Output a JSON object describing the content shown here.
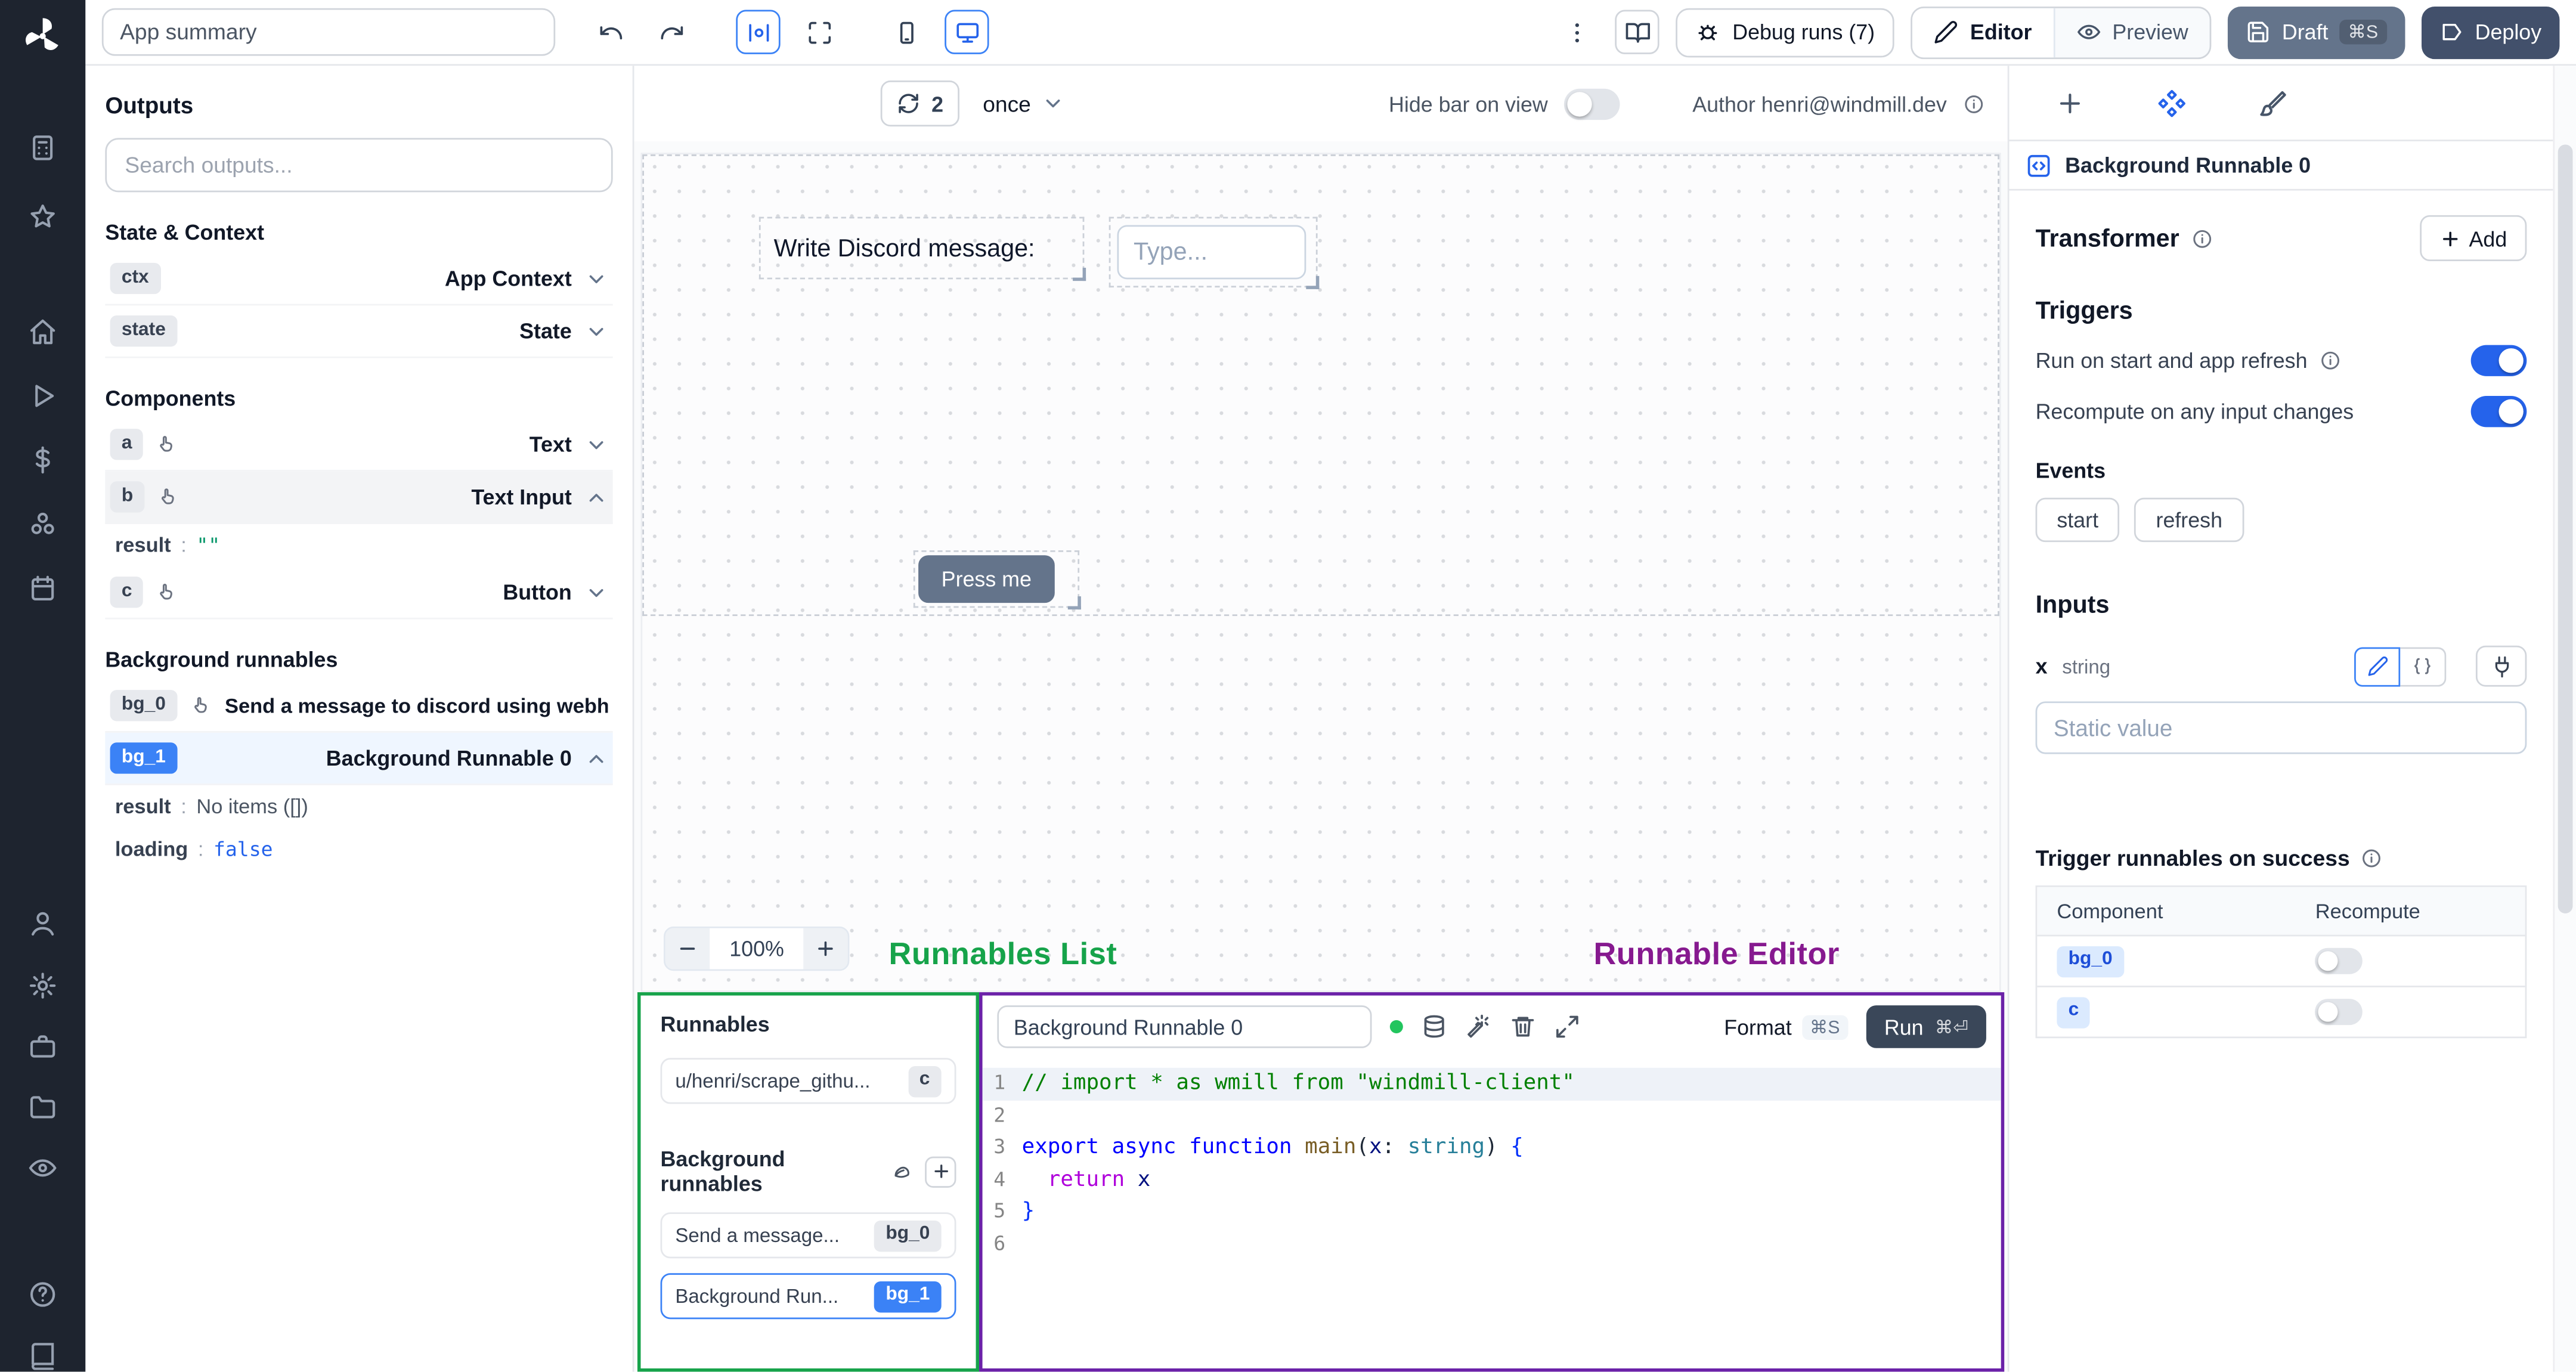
{
  "topbar": {
    "app_summary_value": "App summary",
    "debug_runs_label": "Debug runs (7)",
    "editor_label": "Editor",
    "preview_label": "Preview",
    "draft_label": "Draft",
    "draft_shortcut": "⌘S",
    "deploy_label": "Deploy"
  },
  "outputs": {
    "title": "Outputs",
    "search_placeholder": "Search outputs...",
    "state_context_heading": "State & Context",
    "rows_state": [
      {
        "badge": "ctx",
        "label": "App Context"
      },
      {
        "badge": "state",
        "label": "State"
      }
    ],
    "components_heading": "Components",
    "rows_components": [
      {
        "badge": "a",
        "label": "Text"
      },
      {
        "badge": "b",
        "label": "Text Input"
      },
      {
        "badge": "c",
        "label": "Button"
      }
    ],
    "b_detail": {
      "key": "result",
      "colon": ":",
      "value": "\"\""
    },
    "background_heading": "Background runnables",
    "rows_background": [
      {
        "badge": "bg_0",
        "label": "Send a message to discord using webhoo"
      },
      {
        "badge": "bg_1",
        "label": "Background Runnable 0"
      }
    ],
    "bg1_details": [
      {
        "key": "result",
        "colon": ":",
        "value": "No items ([])"
      },
      {
        "key": "loading",
        "colon": ":",
        "value": "false"
      }
    ]
  },
  "canvas": {
    "refresh_count": "2",
    "interval_value": "once",
    "hide_bar_label": "Hide bar on view",
    "author_label": "Author henri@windmill.dev",
    "text_component": "Write Discord message:",
    "input_placeholder": "Type...",
    "button_label": "Press me",
    "zoom_level": "100%"
  },
  "annotations": {
    "runnables_list": "Runnables List",
    "runnable_editor": "Runnable Editor"
  },
  "runnables": {
    "title": "Runnables",
    "items": [
      {
        "label": "u/henri/scrape_githu...",
        "badge": "c"
      }
    ],
    "background_heading": "Background runnables",
    "background_items": [
      {
        "label": "Send a message...",
        "badge": "bg_0"
      },
      {
        "label": "Background Run...",
        "badge": "bg_1"
      }
    ]
  },
  "editor": {
    "name_value": "Background Runnable 0",
    "format_label": "Format",
    "format_shortcut": "⌘S",
    "run_label": "Run",
    "run_shortcut": "⌘⏎",
    "code": [
      {
        "num": "1",
        "tokens": [
          {
            "c": "comment",
            "t": "// import * as wmill from \"windmill-client\""
          }
        ]
      },
      {
        "num": "2",
        "tokens": []
      },
      {
        "num": "3",
        "tokens": [
          {
            "c": "kw",
            "t": "export"
          },
          {
            "c": "pl",
            "t": " "
          },
          {
            "c": "kw",
            "t": "async"
          },
          {
            "c": "pl",
            "t": " "
          },
          {
            "c": "kw",
            "t": "function"
          },
          {
            "c": "pl",
            "t": " "
          },
          {
            "c": "fn",
            "t": "main"
          },
          {
            "c": "pl",
            "t": "("
          },
          {
            "c": "var",
            "t": "x"
          },
          {
            "c": "pl",
            "t": ": "
          },
          {
            "c": "type",
            "t": "string"
          },
          {
            "c": "pl",
            "t": ") "
          },
          {
            "c": "brace",
            "t": "{"
          }
        ]
      },
      {
        "num": "4",
        "tokens": [
          {
            "c": "pl",
            "t": "  "
          },
          {
            "c": "ctrl",
            "t": "return"
          },
          {
            "c": "var",
            "t": " x"
          }
        ]
      },
      {
        "num": "5",
        "tokens": [
          {
            "c": "brace",
            "t": "}"
          }
        ]
      },
      {
        "num": "6",
        "tokens": []
      }
    ]
  },
  "panel": {
    "header_title": "Background Runnable 0",
    "transformer_heading": "Transformer",
    "add_label": "Add",
    "triggers_heading": "Triggers",
    "trigger_rows": [
      {
        "label": "Run on start and app refresh"
      },
      {
        "label": "Recompute on any input changes"
      }
    ],
    "events_heading": "Events",
    "event_chips": [
      "start",
      "refresh"
    ],
    "inputs_heading": "Inputs",
    "input_name": "x",
    "input_type": "string",
    "static_placeholder": "Static value",
    "success_heading": "Trigger runnables on success",
    "table": {
      "columns": [
        "Component",
        "Recompute"
      ],
      "rows": [
        {
          "badge": "bg_0"
        },
        {
          "badge": "c"
        }
      ]
    }
  },
  "colors": {
    "accent": "#2563eb",
    "selected_badge": "#3b82f6",
    "runnables_border": "#16a34a",
    "editor_border": "#6b21a8"
  }
}
